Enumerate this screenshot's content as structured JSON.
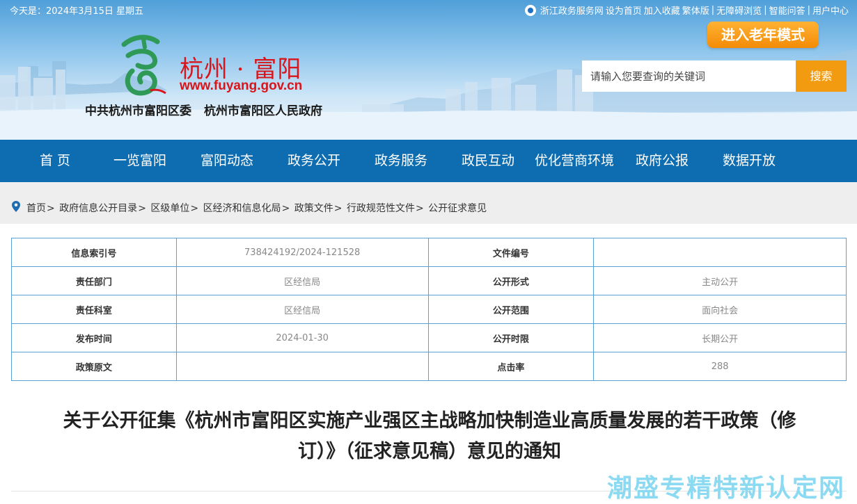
{
  "topbar": {
    "date": "今天是：2024年3月15日 星期五",
    "links": [
      "浙江政务服务网",
      "设为首页",
      "加入收藏",
      "繁体版",
      "|",
      "无障碍浏览",
      "|",
      "智能问答",
      "|",
      "用户中心"
    ]
  },
  "header": {
    "site_name": "杭州 · 富阳",
    "site_url": "www.fuyang.gov.cn",
    "org1": "中共杭州市富阳区委",
    "org2": "杭州市富阳区人民政府",
    "elder_mode": "进入老年模式",
    "search_placeholder": "请输入您要查询的关键词",
    "search_button": "搜索"
  },
  "nav": [
    "首 页",
    "一览富阳",
    "富阳动态",
    "政务公开",
    "政务服务",
    "政民互动",
    "优化营商环境",
    "政府公报",
    "数据开放"
  ],
  "breadcrumb": [
    "首页",
    "政府信息公开目录",
    "区级单位",
    "区经济和信息化局",
    "政策文件",
    "行政规范性文件",
    "公开征求意见"
  ],
  "meta": {
    "rows": [
      [
        "信息索引号",
        "738424192/2024-121528",
        "文件编号",
        ""
      ],
      [
        "责任部门",
        "区经信局",
        "公开形式",
        "主动公开"
      ],
      [
        "责任科室",
        "区经信局",
        "公开范围",
        "面向社会"
      ],
      [
        "发布时间",
        "2024-01-30",
        "公开时限",
        "长期公开"
      ],
      [
        "政策原文",
        "",
        "点击率",
        "288"
      ]
    ]
  },
  "article": {
    "title_line1": "关于公开征集《杭州市富阳区实施产业强区主战略加快制造业高质量发展的若干政策（修",
    "title_line2": "订）》（征求意见稿）意见的通知"
  },
  "watermark": "潮盛专精特新认定网",
  "colors": {
    "nav_bg": "#0e6db1",
    "accent_orange": "#f29b11",
    "brand_red": "#d8151b",
    "table_border": "#5aa1d6"
  }
}
